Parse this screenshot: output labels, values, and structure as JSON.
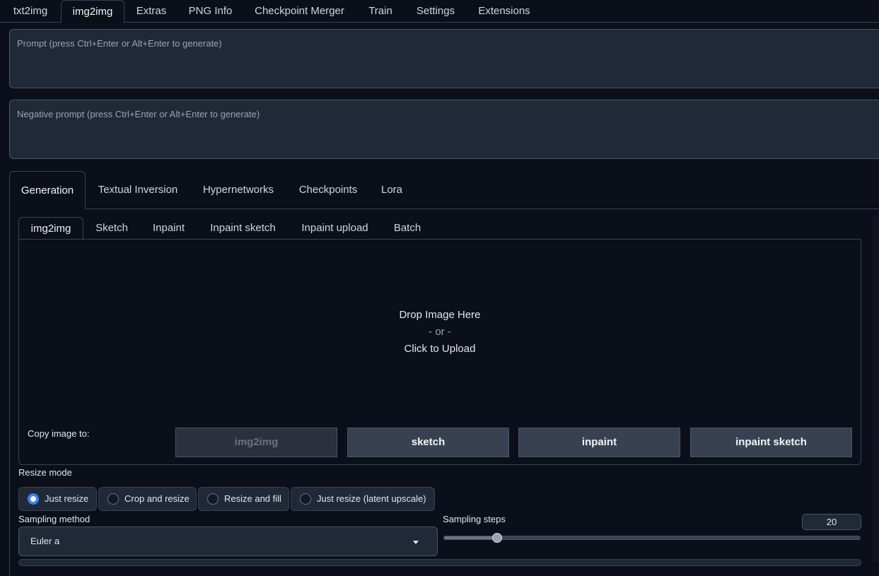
{
  "top_tabs": [
    {
      "label": "txt2img"
    },
    {
      "label": "img2img"
    },
    {
      "label": "Extras"
    },
    {
      "label": "PNG Info"
    },
    {
      "label": "Checkpoint Merger"
    },
    {
      "label": "Train"
    },
    {
      "label": "Settings"
    },
    {
      "label": "Extensions"
    }
  ],
  "active_top_tab": "img2img",
  "prompt": {
    "value": "",
    "placeholder": "Prompt (press Ctrl+Enter or Alt+Enter to generate)"
  },
  "negative_prompt": {
    "value": "",
    "placeholder": "Negative prompt (press Ctrl+Enter or Alt+Enter to generate)"
  },
  "extra_tabs": [
    {
      "label": "Generation"
    },
    {
      "label": "Textual Inversion"
    },
    {
      "label": "Hypernetworks"
    },
    {
      "label": "Checkpoints"
    },
    {
      "label": "Lora"
    }
  ],
  "mode_tabs": [
    {
      "label": "img2img"
    },
    {
      "label": "Sketch"
    },
    {
      "label": "Inpaint"
    },
    {
      "label": "Inpaint sketch"
    },
    {
      "label": "Inpaint upload"
    },
    {
      "label": "Batch"
    }
  ],
  "dropzone": {
    "line1": "Drop Image Here",
    "line2": "- or -",
    "line3": "Click to Upload"
  },
  "copy_image": {
    "label": "Copy image to:",
    "buttons": [
      {
        "label": "img2img",
        "disabled": true
      },
      {
        "label": "sketch",
        "disabled": false
      },
      {
        "label": "inpaint",
        "disabled": false
      },
      {
        "label": "inpaint sketch",
        "disabled": false
      }
    ]
  },
  "resize_mode": {
    "label": "Resize mode",
    "options": [
      {
        "label": "Just resize",
        "checked": true
      },
      {
        "label": "Crop and resize",
        "checked": false
      },
      {
        "label": "Resize and fill",
        "checked": false
      },
      {
        "label": "Just resize (latent upscale)",
        "checked": false
      }
    ]
  },
  "sampling_method": {
    "label": "Sampling method",
    "value": "Euler a"
  },
  "sampling_steps": {
    "label": "Sampling steps",
    "value": "20",
    "min": 1,
    "max": 150
  },
  "colors": {
    "accent": "#3b82f6",
    "background": "#0b0f19",
    "panel": "#1f2937",
    "border": "#374151"
  }
}
